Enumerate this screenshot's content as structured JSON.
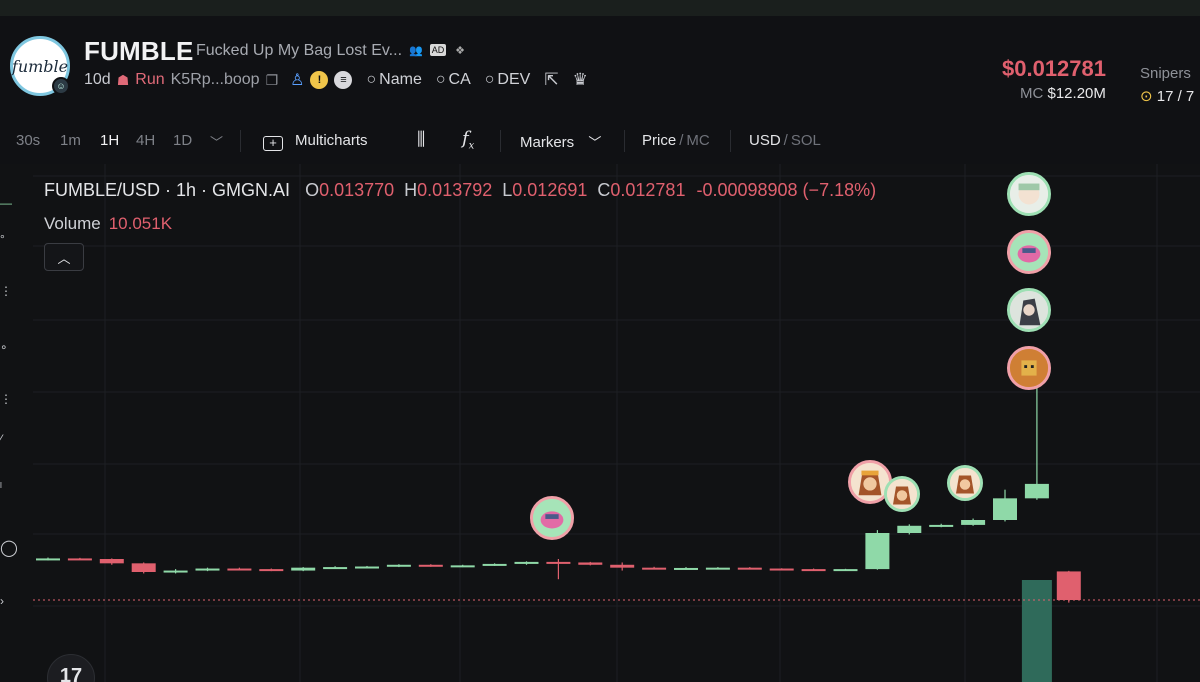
{
  "header": {
    "logo_text": "fumble",
    "token_name": "FUMBLE",
    "token_description": "Fucked Up My Bag Lost Ev...",
    "ad_badge": "AD",
    "age": "10d",
    "run_label": "Run",
    "address": "K5Rp...boop",
    "links": [
      {
        "label": "Name",
        "icon": "search-icon"
      },
      {
        "label": "CA",
        "icon": "search-icon"
      },
      {
        "label": "DEV",
        "icon": "search-icon"
      }
    ],
    "price": "$0.012781",
    "mc_label": "MC",
    "mc_value": "$12.20M",
    "snipers_label": "Snipers",
    "snipers_value": "17 / 7"
  },
  "toolbar": {
    "intervals": [
      "30s",
      "1m",
      "1H",
      "4H",
      "1D"
    ],
    "active_interval": "1H",
    "multicharts": "Multicharts",
    "markers": "Markers",
    "price": "Price",
    "mc": "MC",
    "usd": "USD",
    "sol": "SOL",
    "slash": "/"
  },
  "legend": {
    "pair": "FUMBLE/USD · 1h · GMGN.AI",
    "o_label": "O",
    "o": "0.013770",
    "h_label": "H",
    "h": "0.013792",
    "l_label": "L",
    "l": "0.012691",
    "c_label": "C",
    "c": "0.012781",
    "change": "-0.00098908 (−7.18%)",
    "volume_label": "Volume",
    "volume": "10.051K"
  },
  "colors": {
    "up": "#8fd9a8",
    "down": "#e0606e",
    "price_line": "#e0606e",
    "background": "#111214",
    "grid": "#1d1f23"
  },
  "chart_data": {
    "type": "candlestick",
    "interval": "1h",
    "candles": [
      {
        "o": 0.0142,
        "h": 0.01425,
        "l": 0.01415,
        "c": 0.01422
      },
      {
        "o": 0.01422,
        "h": 0.01424,
        "l": 0.01418,
        "c": 0.0142
      },
      {
        "o": 0.0142,
        "h": 0.01422,
        "l": 0.014,
        "c": 0.01405
      },
      {
        "o": 0.01405,
        "h": 0.01408,
        "l": 0.0137,
        "c": 0.01375
      },
      {
        "o": 0.01375,
        "h": 0.01385,
        "l": 0.0137,
        "c": 0.0138
      },
      {
        "o": 0.0138,
        "h": 0.0139,
        "l": 0.01378,
        "c": 0.01387
      },
      {
        "o": 0.01387,
        "h": 0.0139,
        "l": 0.01382,
        "c": 0.01385
      },
      {
        "o": 0.01385,
        "h": 0.01387,
        "l": 0.01378,
        "c": 0.0138
      },
      {
        "o": 0.0138,
        "h": 0.01392,
        "l": 0.01378,
        "c": 0.0139
      },
      {
        "o": 0.0139,
        "h": 0.01395,
        "l": 0.01388,
        "c": 0.01392
      },
      {
        "o": 0.01392,
        "h": 0.01396,
        "l": 0.0139,
        "c": 0.01394
      },
      {
        "o": 0.01394,
        "h": 0.01402,
        "l": 0.01392,
        "c": 0.014
      },
      {
        "o": 0.014,
        "h": 0.01402,
        "l": 0.01393,
        "c": 0.01395
      },
      {
        "o": 0.01395,
        "h": 0.014,
        "l": 0.01392,
        "c": 0.01398
      },
      {
        "o": 0.01398,
        "h": 0.01405,
        "l": 0.01396,
        "c": 0.01403
      },
      {
        "o": 0.01403,
        "h": 0.01412,
        "l": 0.014,
        "c": 0.0141
      },
      {
        "o": 0.0141,
        "h": 0.0142,
        "l": 0.0135,
        "c": 0.01408
      },
      {
        "o": 0.01408,
        "h": 0.0141,
        "l": 0.01398,
        "c": 0.014
      },
      {
        "o": 0.014,
        "h": 0.01408,
        "l": 0.0138,
        "c": 0.0139
      },
      {
        "o": 0.0139,
        "h": 0.01393,
        "l": 0.01384,
        "c": 0.01386
      },
      {
        "o": 0.01386,
        "h": 0.01392,
        "l": 0.01384,
        "c": 0.01389
      },
      {
        "o": 0.01389,
        "h": 0.01392,
        "l": 0.01386,
        "c": 0.0139
      },
      {
        "o": 0.0139,
        "h": 0.01392,
        "l": 0.01385,
        "c": 0.01387
      },
      {
        "o": 0.01387,
        "h": 0.01388,
        "l": 0.01384,
        "c": 0.01385
      },
      {
        "o": 0.01385,
        "h": 0.01387,
        "l": 0.01381,
        "c": 0.01383
      },
      {
        "o": 0.01383,
        "h": 0.01386,
        "l": 0.0138,
        "c": 0.01385
      },
      {
        "o": 0.01385,
        "h": 0.0152,
        "l": 0.01383,
        "c": 0.0151
      },
      {
        "o": 0.0151,
        "h": 0.0154,
        "l": 0.01505,
        "c": 0.01535
      },
      {
        "o": 0.01535,
        "h": 0.01542,
        "l": 0.0153,
        "c": 0.01538
      },
      {
        "o": 0.01538,
        "h": 0.0156,
        "l": 0.01535,
        "c": 0.01555
      },
      {
        "o": 0.01555,
        "h": 0.0166,
        "l": 0.0155,
        "c": 0.0163
      },
      {
        "o": 0.0163,
        "h": 0.0205,
        "l": 0.01625,
        "c": 0.0168
      },
      {
        "o": 0.01377,
        "h": 0.01379,
        "l": 0.01269,
        "c": 0.01278
      }
    ],
    "current_price": 0.012781,
    "volume_bars": [
      {
        "index": 31,
        "value": 10051
      }
    ]
  }
}
